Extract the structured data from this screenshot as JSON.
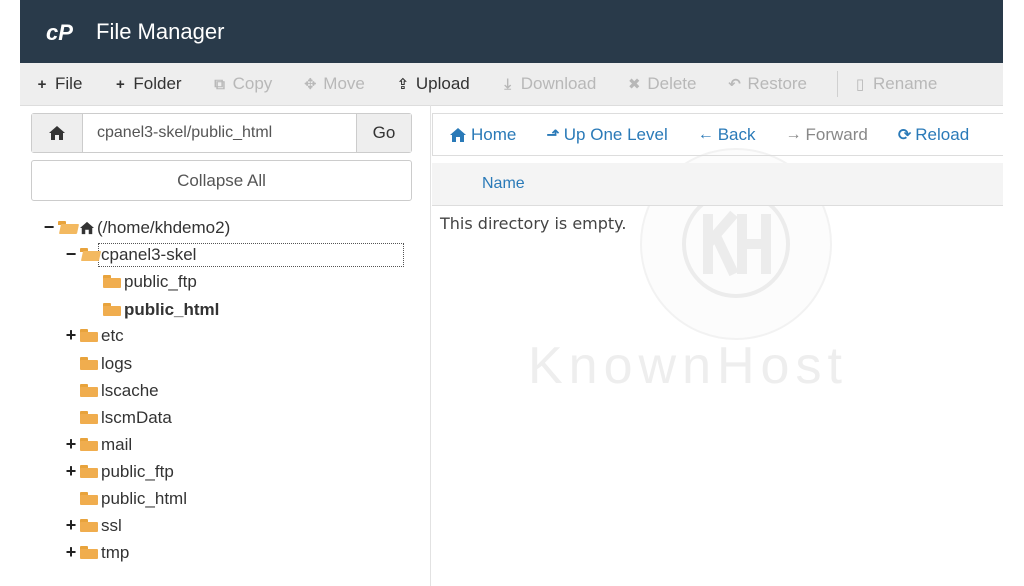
{
  "header": {
    "title": "File Manager",
    "logo_text": "cP"
  },
  "toolbar": {
    "file": "File",
    "folder": "Folder",
    "copy": "Copy",
    "move": "Move",
    "upload": "Upload",
    "download": "Download",
    "delete": "Delete",
    "restore": "Restore",
    "rename": "Rename"
  },
  "sidebar": {
    "path_value": "cpanel3-skel/public_html",
    "go_label": "Go",
    "collapse_label": "Collapse All",
    "tree": {
      "root": "(/home/khdemo2)",
      "cpanel3_skel": "cpanel3-skel",
      "public_ftp_child": "public_ftp",
      "public_html_child": "public_html",
      "etc": "etc",
      "logs": "logs",
      "lscache": "lscache",
      "lscmdata": "lscmData",
      "mail": "mail",
      "public_ftp": "public_ftp",
      "public_html": "public_html",
      "ssl": "ssl",
      "tmp": "tmp"
    }
  },
  "nav": {
    "home": "Home",
    "up": "Up One Level",
    "back": "Back",
    "forward": "Forward",
    "reload": "Reload"
  },
  "list": {
    "col_name": "Name",
    "empty_message": "This directory is empty."
  },
  "watermark": {
    "text": "KnownHost"
  },
  "colors": {
    "header_bg": "#293a4a",
    "link": "#2a7ab8",
    "folder": "#f0ad4e"
  }
}
